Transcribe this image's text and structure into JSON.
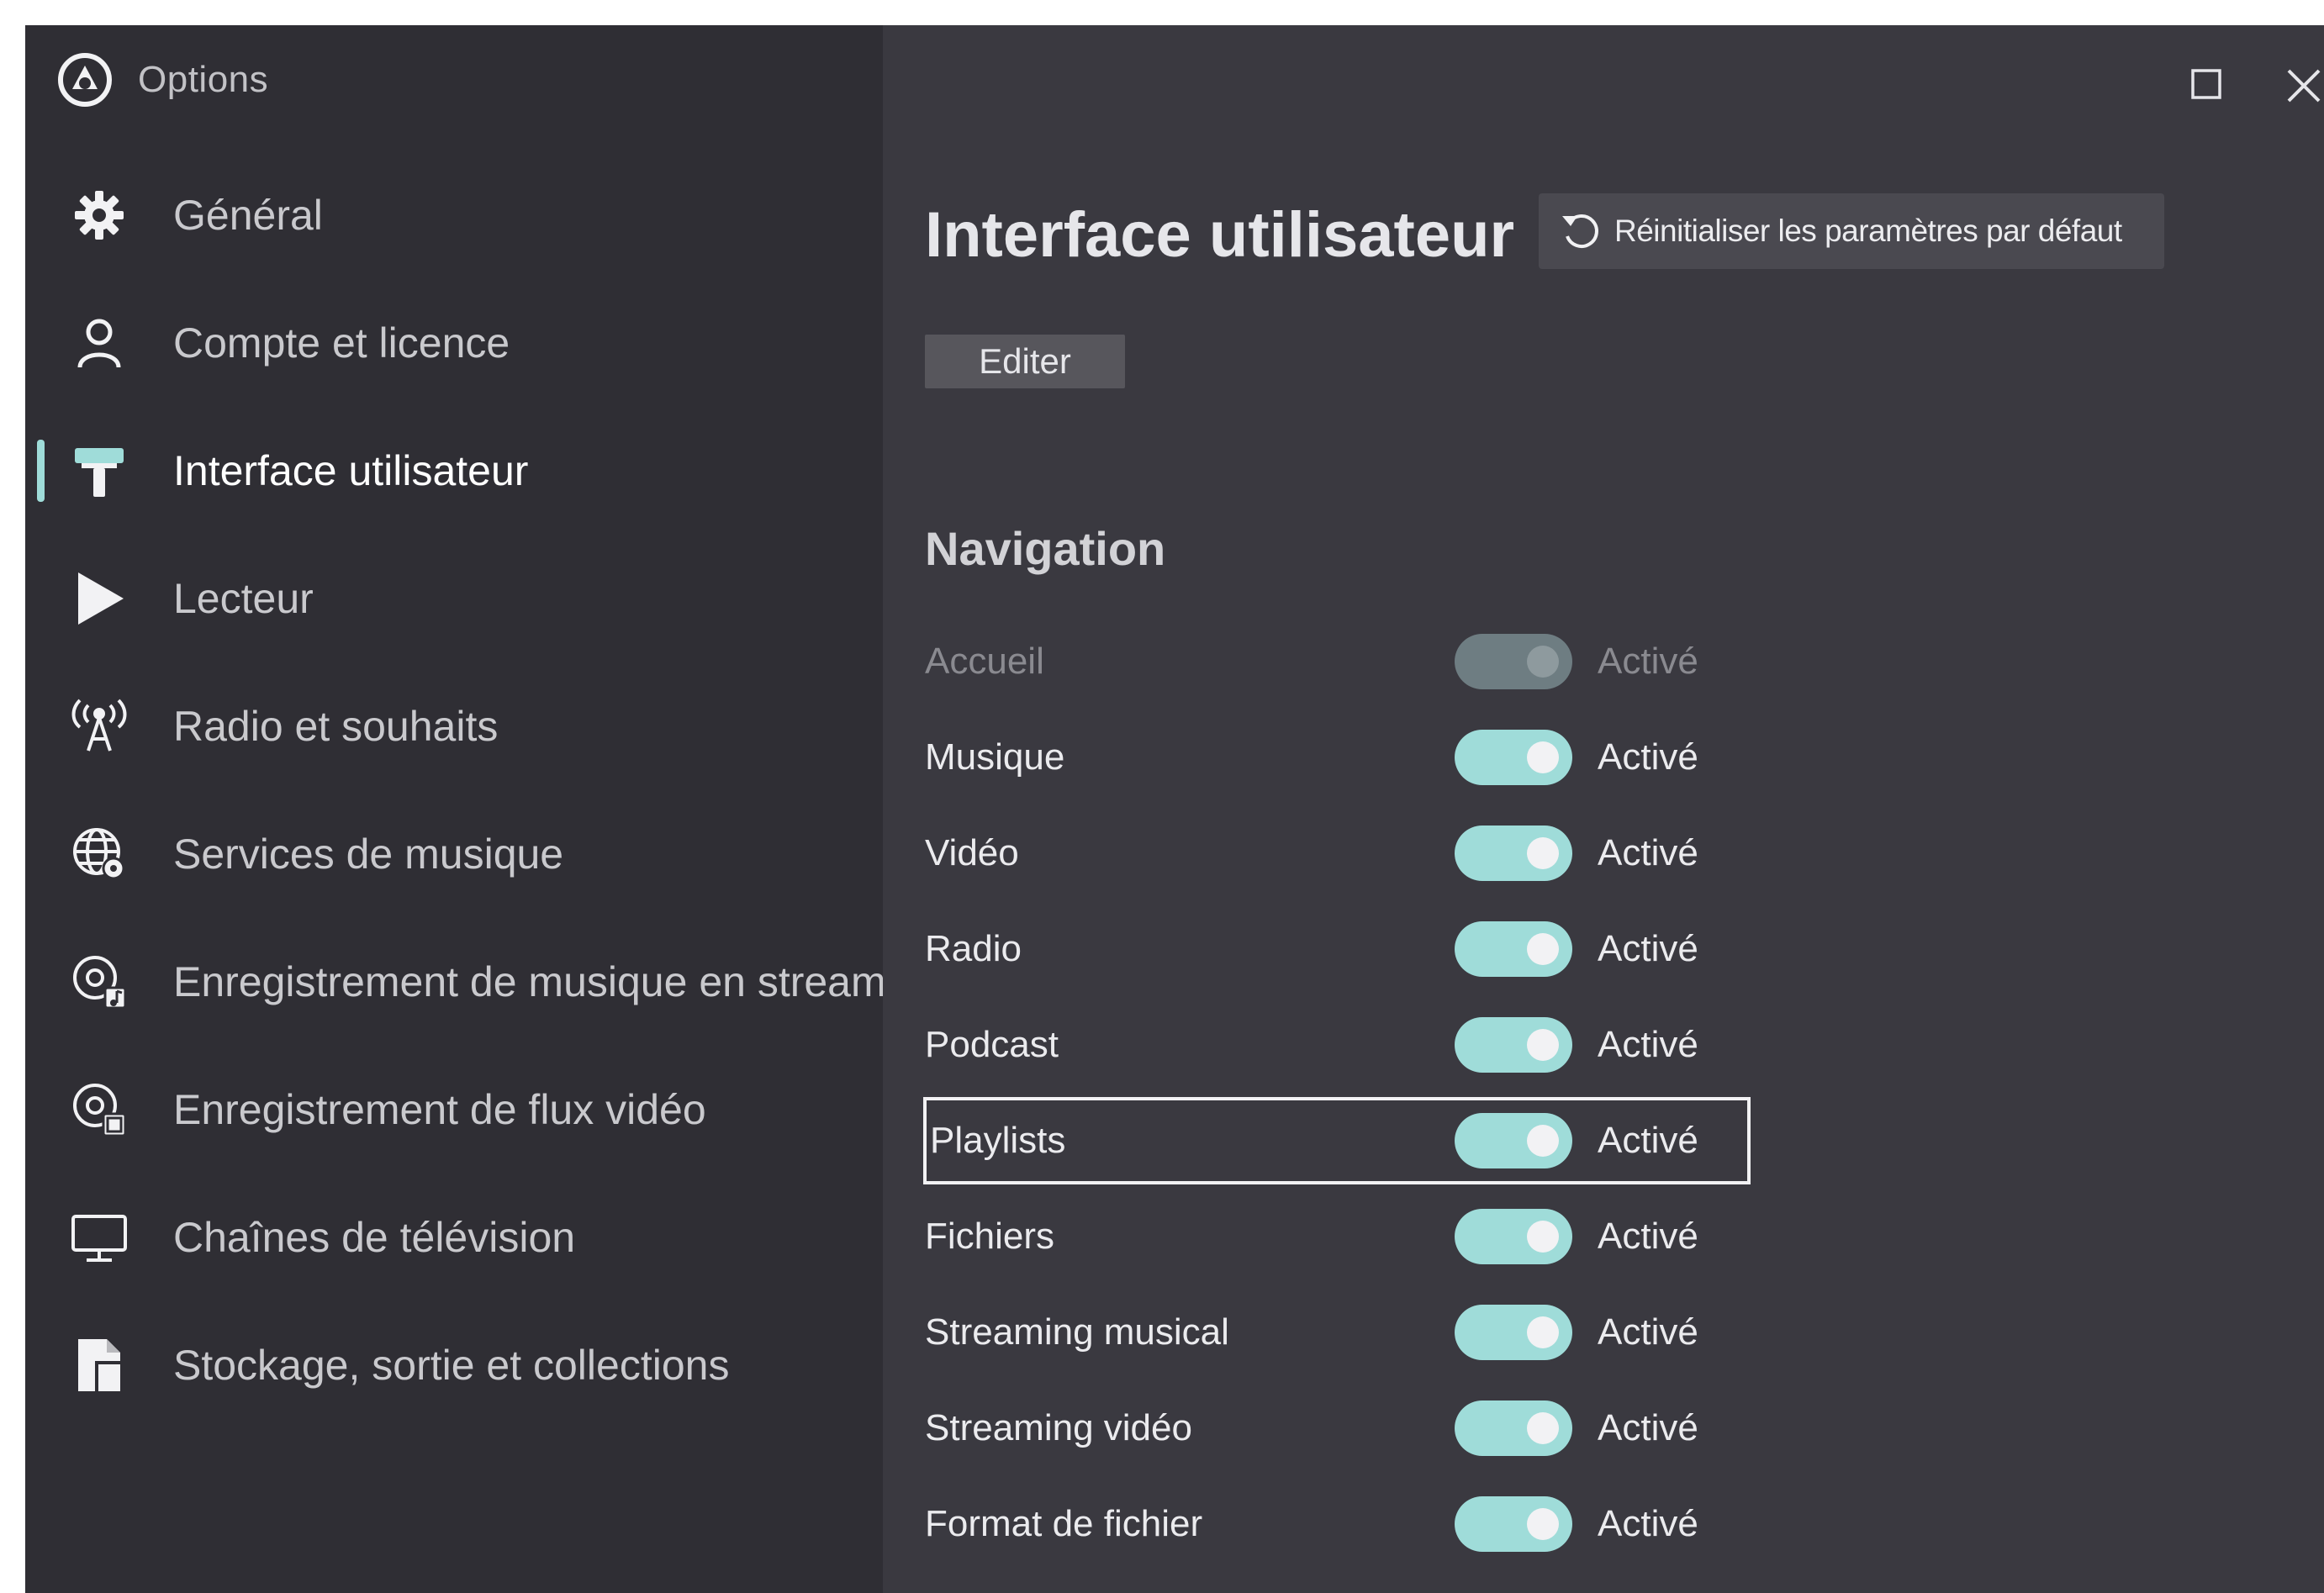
{
  "window": {
    "title": "Options"
  },
  "sidebar": {
    "items": [
      {
        "label": "Général",
        "icon": "gear-icon"
      },
      {
        "label": "Compte et licence",
        "icon": "user-icon"
      },
      {
        "label": "Interface utilisateur",
        "icon": "paint-roller-icon",
        "active": true
      },
      {
        "label": "Lecteur",
        "icon": "play-icon"
      },
      {
        "label": "Radio et souhaits",
        "icon": "radio-tower-icon"
      },
      {
        "label": "Services de musique",
        "icon": "globe-icon"
      },
      {
        "label": "Enregistrement de musique en streami",
        "icon": "music-record-icon"
      },
      {
        "label": "Enregistrement de flux vidéo",
        "icon": "video-record-icon"
      },
      {
        "label": "Chaînes de télévision",
        "icon": "monitor-icon"
      },
      {
        "label": "Stockage, sortie et collections",
        "icon": "document-icon"
      }
    ]
  },
  "main": {
    "title": "Interface utilisateur",
    "reset_button": "Réinitialiser les paramètres par défaut",
    "edit_button": "Editer",
    "navigation": {
      "title": "Navigation",
      "rows": [
        {
          "label": "Accueil",
          "state": "Activé",
          "enabled": true,
          "disabled": true
        },
        {
          "label": "Musique",
          "state": "Activé",
          "enabled": true
        },
        {
          "label": "Vidéo",
          "state": "Activé",
          "enabled": true
        },
        {
          "label": "Radio",
          "state": "Activé",
          "enabled": true
        },
        {
          "label": "Podcast",
          "state": "Activé",
          "enabled": true
        },
        {
          "label": "Playlists",
          "state": "Activé",
          "enabled": true,
          "focused": true
        },
        {
          "label": "Fichiers",
          "state": "Activé",
          "enabled": true
        },
        {
          "label": "Streaming musical",
          "state": "Activé",
          "enabled": true
        },
        {
          "label": "Streaming vidéo",
          "state": "Activé",
          "enabled": true
        },
        {
          "label": "Format de fichier",
          "state": "Activé",
          "enabled": true
        }
      ]
    }
  },
  "colors": {
    "sidebar_bg": "#2f2e34",
    "content_bg": "#3a3940",
    "accent": "#9fdcd9",
    "text": "#ebebee"
  }
}
